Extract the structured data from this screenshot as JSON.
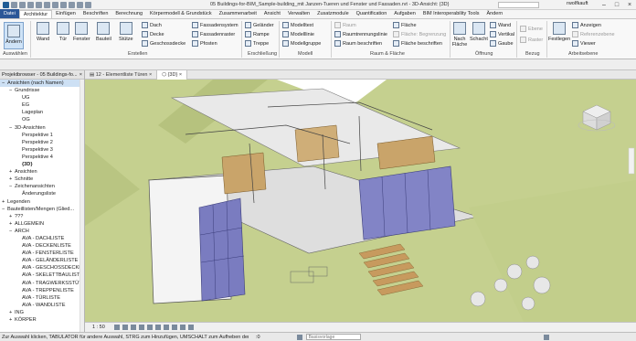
{
  "title_bar": {
    "document_title": "05 Buildings-for-BIM_Sample-building_mit Janzen-Tueren und Fenster und Fassaden.rvt - 3D-Ansicht: {3D}",
    "user": "rwolfkauft"
  },
  "ribbon_tabs": [
    "Datei",
    "Architektur",
    "Einfügen",
    "Beschriften",
    "Berechnung",
    "Körpermodell & Grundstück",
    "Zusammenarbeit",
    "Ansicht",
    "Verwalten",
    "Zusatzmodule",
    "Quantification",
    "Aufgaben",
    "BIM Interoperability Tools",
    "Ändern"
  ],
  "ribbon": {
    "select": {
      "modify": "Ändern",
      "group": "Auswählen"
    },
    "build": {
      "wall": "Wand",
      "door": "Tür",
      "window": "Fenster",
      "component": "Bauteil",
      "column": "Stütze",
      "roof": "Dach",
      "ceiling": "Decke",
      "floor": "Geschossdecke",
      "curtain_system": "Fassadensystem",
      "curtain_grid": "Fassadenraster",
      "mullion": "Pfosten",
      "group": "Erstellen"
    },
    "circulation": {
      "railing": "Geländer",
      "ramp": "Rampe",
      "stair": "Treppe",
      "group": "Erschließung"
    },
    "model": {
      "text": "Modelltext",
      "line": "Modelllinie",
      "group_btn": "Modellgruppe",
      "group": "Modell"
    },
    "room": {
      "room": "Raum",
      "separator": "Raumtrennungslinie",
      "tag_room": "Raum beschriften",
      "area": "Fläche",
      "area_boundary": "Fläche: Begrenzung",
      "tag_area": "Fläche beschriften",
      "group": "Raum & Fläche"
    },
    "opening": {
      "by_face": "Nach Fläche",
      "shaft": "Schacht",
      "wall": "Wand",
      "vertical": "Vertikal",
      "dormer": "Gaube",
      "group": "Öffnung"
    },
    "datum": {
      "level": "Ebene",
      "grid": "Raster",
      "group": "Bezug"
    },
    "work_plane": {
      "set": "Festlegen",
      "show": "Anzeigen",
      "ref_plane": "Referenzebene",
      "viewer": "Viewer",
      "group": "Arbeitsebene"
    }
  },
  "view_tabs": [
    {
      "label": "12 - Elementliste Türen"
    },
    {
      "label": "{3D}"
    }
  ],
  "project_browser": {
    "title": "Projektbrowser - 05 Buildings-fo...",
    "items": [
      {
        "label": "Ansichten (nach Namen)",
        "level": 0,
        "toggle": "−",
        "selected": true
      },
      {
        "label": "Grundrisse",
        "level": 1,
        "toggle": "−"
      },
      {
        "label": "UG",
        "level": 2
      },
      {
        "label": "EG",
        "level": 2
      },
      {
        "label": "Lageplan",
        "level": 2
      },
      {
        "label": "OG",
        "level": 2
      },
      {
        "label": "3D-Ansichten",
        "level": 1,
        "toggle": "−"
      },
      {
        "label": "Perspektive 1",
        "level": 2
      },
      {
        "label": "Perspektive 2",
        "level": 2
      },
      {
        "label": "Perspektive 3",
        "level": 2
      },
      {
        "label": "Perspektive 4",
        "level": 2
      },
      {
        "label": "{3D}",
        "level": 2,
        "bold": true
      },
      {
        "label": "Ansichten",
        "level": 1,
        "toggle": "+"
      },
      {
        "label": "Schnitte",
        "level": 1,
        "toggle": "+"
      },
      {
        "label": "Zeichenansichten",
        "level": 1,
        "toggle": "−"
      },
      {
        "label": "Änderungsliste",
        "level": 2
      },
      {
        "label": "Legenden",
        "level": 0,
        "toggle": "+"
      },
      {
        "label": "Bauteillisten/Mengen (Glied...",
        "level": 0,
        "toggle": "−"
      },
      {
        "label": "???",
        "level": 1,
        "toggle": "+"
      },
      {
        "label": "ALLGEMEIN",
        "level": 1,
        "toggle": "+"
      },
      {
        "label": "ARCH",
        "level": 1,
        "toggle": "−"
      },
      {
        "label": "AVA - DACHLISTE",
        "level": 2
      },
      {
        "label": "AVA - DECKENLISTE",
        "level": 2
      },
      {
        "label": "AVA - FENSTERLISTE",
        "level": 2
      },
      {
        "label": "AVA - GELÄNDERLISTE",
        "level": 2
      },
      {
        "label": "AVA - GESCHOSSDECKE",
        "level": 2
      },
      {
        "label": "AVA - SKELETTBAULISTE",
        "level": 2
      },
      {
        "label": "AVA - TRAGWERKSSTÜT",
        "level": 2
      },
      {
        "label": "AVA - TREPPENLISTE",
        "level": 2
      },
      {
        "label": "AVA - TÜRLISTE",
        "level": 2
      },
      {
        "label": "AVA - WANDLISTE",
        "level": 2
      },
      {
        "label": "ING",
        "level": 1,
        "toggle": "+"
      },
      {
        "label": "KÖRPER",
        "level": 1,
        "toggle": "+"
      }
    ]
  },
  "view_control_bar": {
    "scale": "1 : 50"
  },
  "status_bar": {
    "hint": "Zur Auswahl klicken, TABULATOR für andere Auswahl, STRG zum Hinzufügen, UMSCHALT zum Aufheben der Au",
    "zero": ":0",
    "model_label": "Basisvorlage"
  },
  "colors": {
    "accent": "#2b5797",
    "grass": "#c4d08c",
    "glass": "#7d7fc0",
    "wood": "#c9a46a"
  }
}
